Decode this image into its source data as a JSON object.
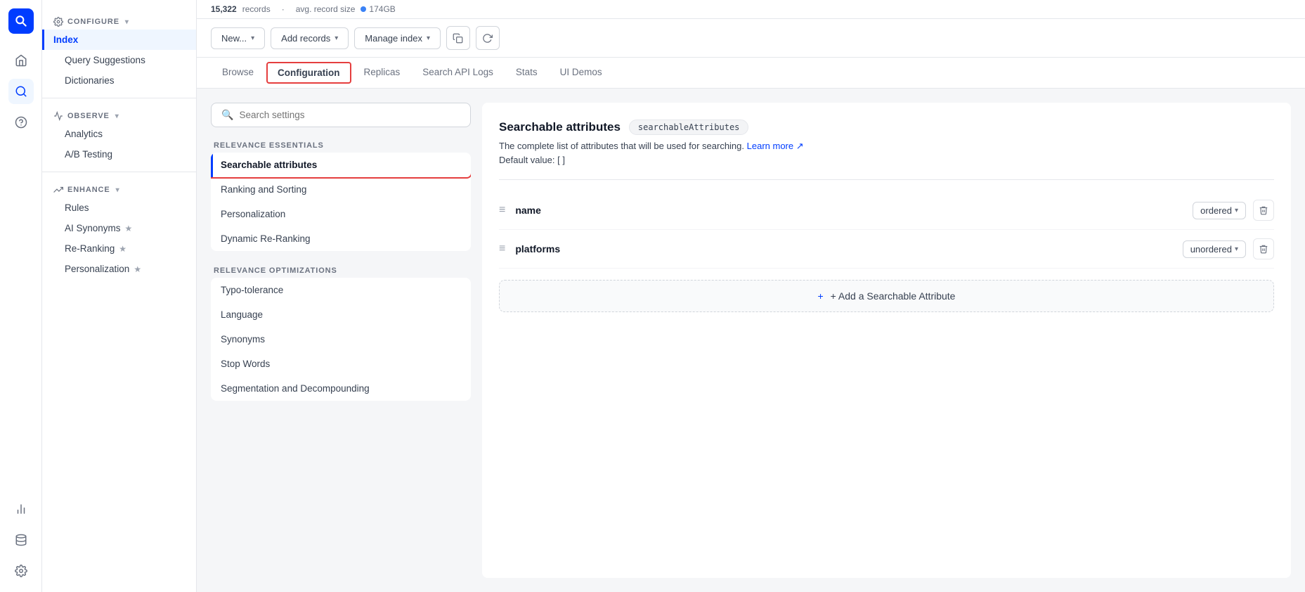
{
  "app": {
    "title": "SEARCH"
  },
  "records_bar": {
    "records_label": "records",
    "records_count": "15,322",
    "avg_size_label": "avg. record size",
    "size_value": "174GB"
  },
  "toolbar": {
    "new_label": "New...",
    "add_records_label": "Add records",
    "manage_index_label": "Manage index"
  },
  "tabs": [
    {
      "id": "browse",
      "label": "Browse"
    },
    {
      "id": "configuration",
      "label": "Configuration",
      "active": true
    },
    {
      "id": "replicas",
      "label": "Replicas"
    },
    {
      "id": "search_api_logs",
      "label": "Search API Logs"
    },
    {
      "id": "stats",
      "label": "Stats"
    },
    {
      "id": "ui_demos",
      "label": "UI Demos"
    }
  ],
  "sidebar": {
    "configure_label": "CONFIGURE",
    "index_label": "Index",
    "query_suggestions_label": "Query Suggestions",
    "dictionaries_label": "Dictionaries",
    "observe_label": "OBSERVE",
    "analytics_label": "Analytics",
    "ab_testing_label": "A/B Testing",
    "enhance_label": "ENHANCE",
    "rules_label": "Rules",
    "ai_synonyms_label": "AI Synonyms",
    "re_ranking_label": "Re-Ranking",
    "personalization_label": "Personalization"
  },
  "settings_panel": {
    "search_placeholder": "Search settings",
    "relevance_essentials_label": "RELEVANCE ESSENTIALS",
    "items": [
      {
        "id": "searchable_attributes",
        "label": "Searchable attributes",
        "active": true
      },
      {
        "id": "ranking_sorting",
        "label": "Ranking and Sorting"
      },
      {
        "id": "personalization",
        "label": "Personalization"
      },
      {
        "id": "dynamic_reranking",
        "label": "Dynamic Re-Ranking"
      }
    ],
    "relevance_optimizations_label": "RELEVANCE OPTIMIZATIONS",
    "optimizations": [
      {
        "id": "typo_tolerance",
        "label": "Typo-tolerance"
      },
      {
        "id": "language",
        "label": "Language"
      },
      {
        "id": "synonyms",
        "label": "Synonyms"
      },
      {
        "id": "stop_words",
        "label": "Stop Words"
      },
      {
        "id": "segmentation",
        "label": "Segmentation and Decompounding"
      }
    ]
  },
  "right_panel": {
    "title": "Searchable attributes",
    "badge": "searchableAttributes",
    "description": "The complete list of attributes that will be used for searching.",
    "learn_more_label": "Learn more",
    "default_value_label": "Default value:",
    "default_value": "[ ]",
    "attributes": [
      {
        "id": "name",
        "name": "name",
        "order": "ordered"
      },
      {
        "id": "platforms",
        "name": "platforms",
        "order": "unordered"
      }
    ],
    "add_button_label": "+ Add a Searchable Attribute",
    "order_options": [
      "ordered",
      "unordered"
    ]
  }
}
